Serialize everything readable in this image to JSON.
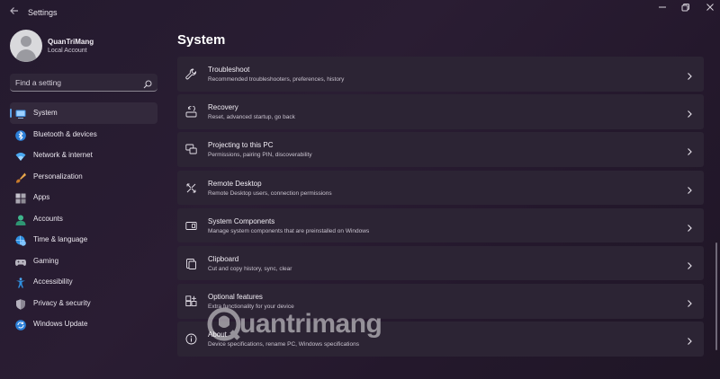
{
  "window": {
    "title": "Settings",
    "back_icon": "back-arrow-icon",
    "controls": [
      "minimize-icon",
      "maximize-icon",
      "close-icon"
    ]
  },
  "profile": {
    "name": "QuanTriMang",
    "account_type": "Local Account"
  },
  "search": {
    "placeholder": "Find a setting",
    "icon": "search-icon"
  },
  "sidebar": {
    "items": [
      {
        "label": "System",
        "icon": "system-icon",
        "active": true
      },
      {
        "label": "Bluetooth & devices",
        "icon": "bluetooth-icon"
      },
      {
        "label": "Network & internet",
        "icon": "wifi-icon"
      },
      {
        "label": "Personalization",
        "icon": "brush-icon"
      },
      {
        "label": "Apps",
        "icon": "apps-icon"
      },
      {
        "label": "Accounts",
        "icon": "accounts-icon"
      },
      {
        "label": "Time & language",
        "icon": "globe-clock-icon"
      },
      {
        "label": "Gaming",
        "icon": "gamepad-icon"
      },
      {
        "label": "Accessibility",
        "icon": "accessibility-icon"
      },
      {
        "label": "Privacy & security",
        "icon": "shield-icon"
      },
      {
        "label": "Windows Update",
        "icon": "update-icon"
      }
    ]
  },
  "main": {
    "title": "System",
    "cards": [
      {
        "title": "Troubleshoot",
        "subtitle": "Recommended troubleshooters, preferences, history",
        "icon": "wrench-icon"
      },
      {
        "title": "Recovery",
        "subtitle": "Reset, advanced startup, go back",
        "icon": "recovery-icon"
      },
      {
        "title": "Projecting to this PC",
        "subtitle": "Permissions, pairing PIN, discoverability",
        "icon": "projecting-icon"
      },
      {
        "title": "Remote Desktop",
        "subtitle": "Remote Desktop users, connection permissions",
        "icon": "remote-desktop-icon"
      },
      {
        "title": "System Components",
        "subtitle": "Manage system components that are preinstalled on Windows",
        "icon": "components-icon"
      },
      {
        "title": "Clipboard",
        "subtitle": "Cut and copy history, sync, clear",
        "icon": "clipboard-icon"
      },
      {
        "title": "Optional features",
        "subtitle": "Extra functionality for your device",
        "icon": "optional-features-icon"
      },
      {
        "title": "About",
        "subtitle": "Device specifications, rename PC, Windows specifications",
        "icon": "info-icon"
      }
    ]
  },
  "watermark": {
    "text": "uantrimang"
  },
  "colors": {
    "accent": "#5aa0e6",
    "background": "#241a2e",
    "card": "#2c2434",
    "sidebar_active": "#33293c"
  }
}
